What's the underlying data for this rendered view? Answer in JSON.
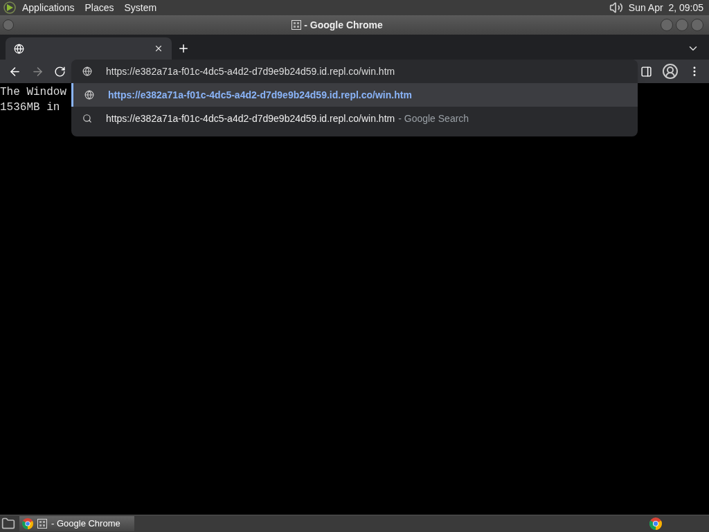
{
  "top_panel": {
    "menus": [
      "Applications",
      "Places",
      "System"
    ],
    "clock": "Sun Apr  2, 09:05"
  },
  "window": {
    "title": "- Google Chrome"
  },
  "tabs": [
    {
      "selected": true
    }
  ],
  "omnibox": {
    "value": "https://e382a71a-f01c-4dc5-a4d2-d7d9e9b24d59.id.repl.co/win.htm"
  },
  "suggestions": [
    {
      "kind": "url",
      "text": "https://e382a71a-f01c-4dc5-a4d2-d7d9e9b24d59.id.repl.co/win.htm",
      "selected": true
    },
    {
      "kind": "search",
      "text": "https://e382a71a-f01c-4dc5-a4d2-d7d9e9b24d59.id.repl.co/win.htm",
      "suffix": "- Google Search",
      "selected": false
    }
  ],
  "page_lines": [
    "The Window",
    "1536MB in"
  ],
  "taskbar": {
    "tasks": [
      {
        "label": "- Google Chrome",
        "selected": true
      }
    ]
  }
}
